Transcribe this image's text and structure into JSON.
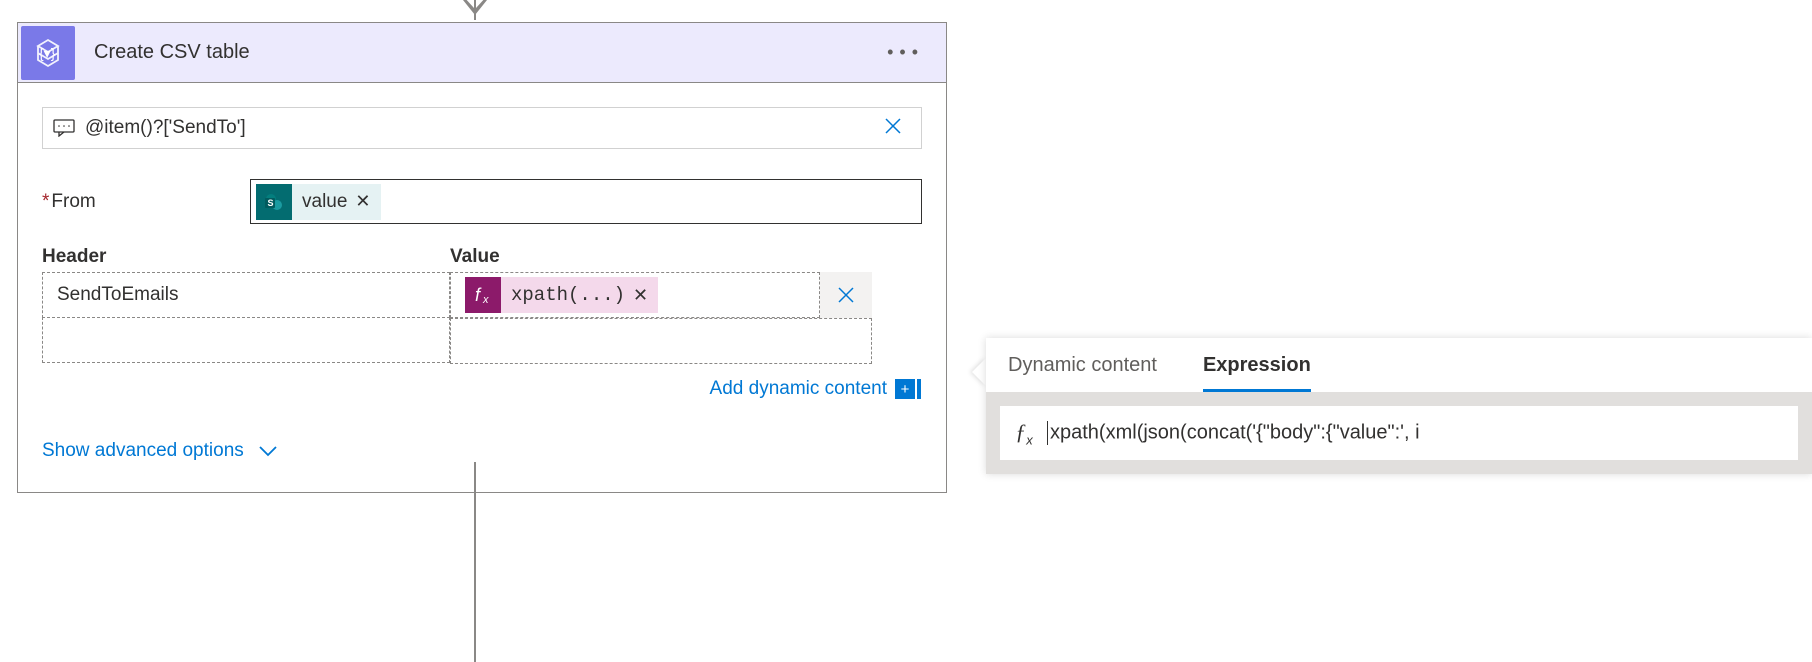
{
  "card": {
    "title": "Create CSV table",
    "conditionExpression": "@item()?['SendTo']",
    "fromLabel": "From",
    "fromChip": {
      "label": "value"
    }
  },
  "columns": {
    "headerLabel": "Header",
    "valueLabel": "Value",
    "rows": [
      {
        "header": "SendToEmails",
        "valueExpr": "xpath(...)"
      },
      {
        "header": "",
        "valueExpr": ""
      }
    ]
  },
  "links": {
    "addDynamic": "Add dynamic content",
    "showAdvanced": "Show advanced options"
  },
  "popup": {
    "tabDynamic": "Dynamic content",
    "tabExpression": "Expression",
    "expression": "xpath(xml(json(concat('{\"body\":{\"value\":', i"
  }
}
